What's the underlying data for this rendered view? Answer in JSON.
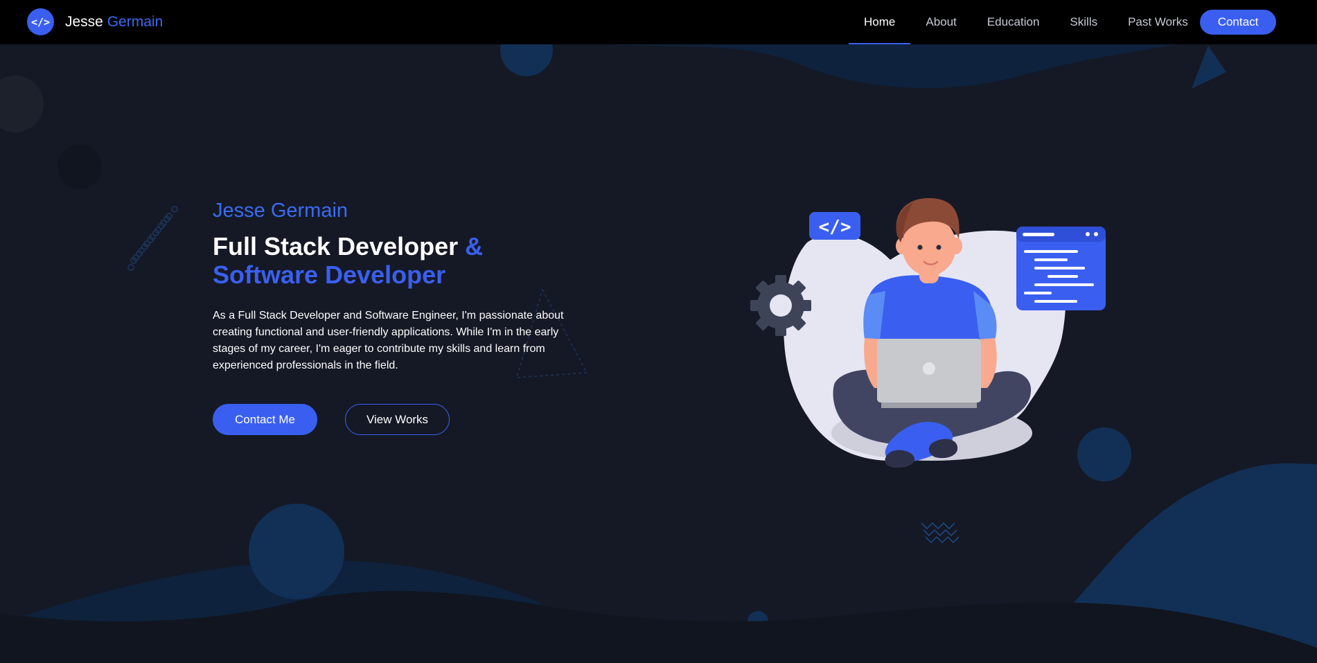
{
  "brand": {
    "logo": "</>",
    "first_name": "Jesse",
    "last_name": "Germain"
  },
  "nav": {
    "links": [
      "Home",
      "About",
      "Education",
      "Skills",
      "Past Works"
    ],
    "active": "Home",
    "contact_label": "Contact"
  },
  "hero": {
    "name": "Jesse Germain",
    "title_line1": "Full Stack Developer",
    "ampersand": "&",
    "title_line2": "Software Developer",
    "description": "As a Full Stack Developer and Software Engineer, I'm passionate about creating functional and user-friendly applications. While I'm in the early stages of my career, I'm eager to contribute my skills and learn from experienced professionals in the field.",
    "primary_button": "Contact Me",
    "secondary_button": "View Works"
  },
  "illustration": {
    "code_badge": "</>"
  },
  "colors": {
    "background": "#151925",
    "navbar": "#000000",
    "accent": "#3a5ff0",
    "accent_text": "#3a6cf4",
    "wave": "#0e223d",
    "bubble": "#123056"
  }
}
